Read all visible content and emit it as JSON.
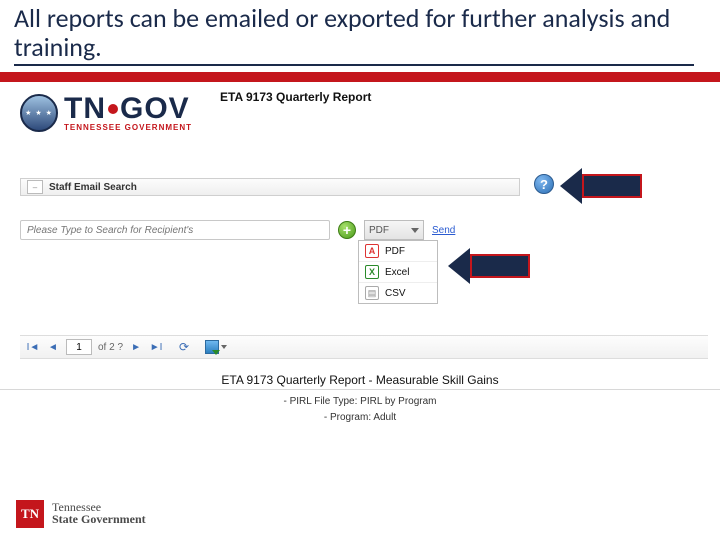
{
  "title": "All reports can be emailed or exported for further analysis and training.",
  "report_title": "ETA 9173 Quarterly Report",
  "brand": {
    "main_tn": "TN",
    "main_gov": "GOV",
    "sub": "TENNESSEE GOVERNMENT"
  },
  "section": {
    "label": "Staff Email Search"
  },
  "search": {
    "placeholder": "Please Type to Search for Recipient's"
  },
  "format_dropdown": {
    "selected": "PDF"
  },
  "send_link": "Send",
  "format_options": {
    "pdf": "PDF",
    "excel": "Excel",
    "csv": "CSV"
  },
  "pager": {
    "page_value": "1",
    "of_text": "of 2 ?"
  },
  "sub_report_title": "ETA 9173 Quarterly Report - Measurable Skill Gains",
  "meta": {
    "line1": "- PIRL File Type: PIRL by Program",
    "line2": "- Program: Adult"
  },
  "footer": {
    "badge": "TN",
    "line1": "Tennessee",
    "line2": "State Government"
  }
}
